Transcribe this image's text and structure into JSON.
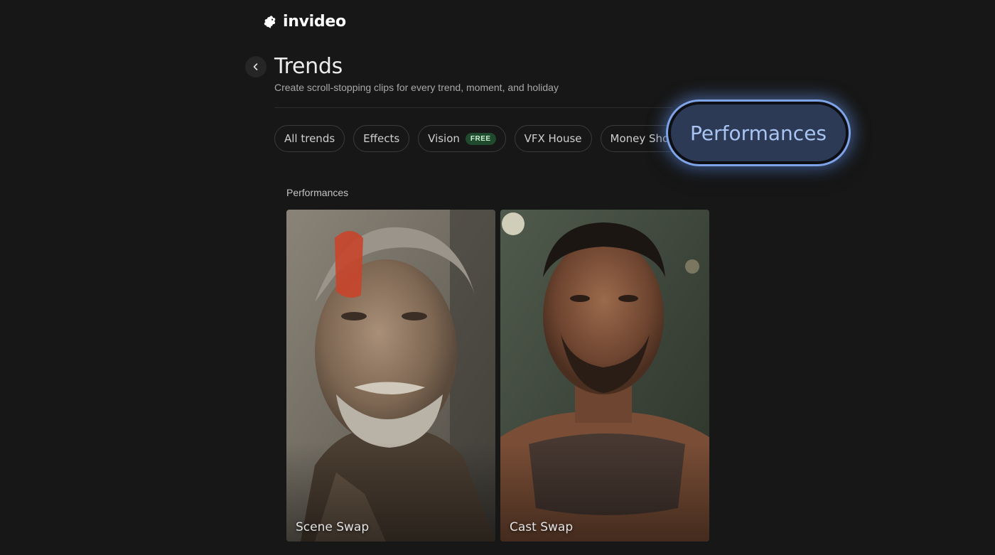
{
  "brand": {
    "name": "invideo",
    "icon": "invideo-logo-icon"
  },
  "header": {
    "back_icon": "chevron-left-icon",
    "title": "Trends",
    "subtitle": "Create scroll-stopping clips for every trend, moment, and holiday"
  },
  "filters": {
    "items": [
      {
        "label": "All trends"
      },
      {
        "label": "Effects"
      },
      {
        "label": "Vision",
        "badge": "FREE"
      },
      {
        "label": "VFX House"
      },
      {
        "label": "Money Shot"
      }
    ],
    "highlighted": {
      "label": "Performances",
      "accent": "#7ea3e6"
    }
  },
  "section": {
    "title": "Performances",
    "cards": [
      {
        "label": "Scene Swap"
      },
      {
        "label": "Cast Swap"
      }
    ]
  }
}
